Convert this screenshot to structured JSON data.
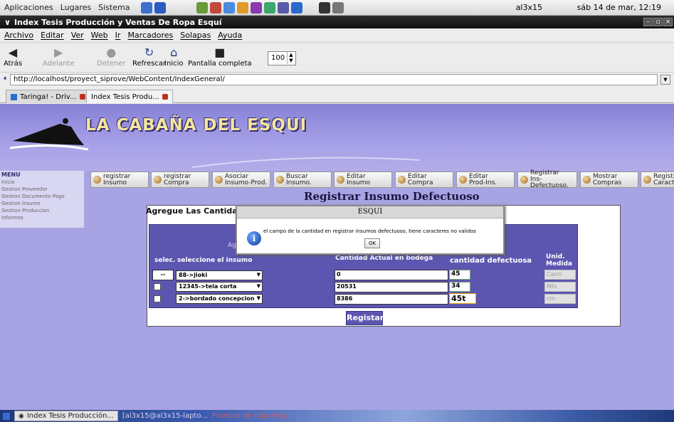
{
  "top_panel": {
    "menus": [
      "Aplicaciones",
      "Lugares",
      "Sistema"
    ],
    "user": "al3x15",
    "clock": "sáb 14 de mar, 12:19"
  },
  "window": {
    "title": "Index Tesis Producción y Ventas De Ropa Esquí"
  },
  "menubar": {
    "items": [
      "Archivo",
      "Editar",
      "Ver",
      "Web",
      "Ir",
      "Marcadores",
      "Solapas",
      "Ayuda"
    ]
  },
  "toolbar": {
    "back": "Atrás",
    "forward": "Adelante",
    "stop": "Detener",
    "reload": "Refrescar",
    "home": "Inicio",
    "fullscreen": "Pantalla completa",
    "zoom": "100"
  },
  "address": {
    "url": "http://localhost/proyect_siprove/WebContent/IndexGeneral/"
  },
  "tabs": [
    {
      "label": "Taringa! - Driv..."
    },
    {
      "label": "Index Tesis Produ..."
    }
  ],
  "site": {
    "title": "LA CABAÑA DEL ESQUI"
  },
  "sidebar": {
    "heading": "MENU",
    "items": [
      "Inicio",
      "Gestion Proveedor",
      "Gestion Documento Pago",
      "Gestion Insumo",
      "Gestion Produccion",
      "Informes"
    ]
  },
  "nav": [
    {
      "l1": "registrar",
      "l2": "Insumo"
    },
    {
      "l1": "registrar",
      "l2": "Compra"
    },
    {
      "l1": "Asociar",
      "l2": "Insumo-Prod."
    },
    {
      "l1": "Buscar",
      "l2": "Insumo."
    },
    {
      "l1": "Editar",
      "l2": "Insumo"
    },
    {
      "l1": "Editar",
      "l2": "Compra"
    },
    {
      "l1": "Editar",
      "l2": "Prod-Ins."
    },
    {
      "l1": "Registrar",
      "l2": "Ins-Defectuoso."
    },
    {
      "l1": "Mostrar",
      "l2": "Compras"
    },
    {
      "l1": "Registr",
      "l2": "Caract"
    }
  ],
  "page": {
    "title": "Registrar Insumo Defectuoso",
    "panel_title": "Agregue Las Cantidades",
    "inner_label": "Ag",
    "headers": {
      "selec": "selec.",
      "insumo": "seleccione el insumo",
      "cantidad": "Cantidad Actual en bodega",
      "defectuosa": "cantidad defectuosa",
      "unidad": "Unid. Medida"
    },
    "rows": [
      {
        "check": "--",
        "insumo": "88->jioki",
        "cantidad": "0",
        "defectuosa": "45",
        "unidad": "Carril"
      },
      {
        "check": "",
        "insumo": "12345->tela corta",
        "cantidad": "20531",
        "defectuosa": "34",
        "unidad": "Mts"
      },
      {
        "check": "",
        "insumo": "2->bordado concepcion",
        "cantidad": "8386",
        "defectuosa": "45t",
        "unidad": "cm"
      }
    ],
    "submit": "Registar"
  },
  "dialog": {
    "title": "ESQUI",
    "message": "el campo de la cantidad en registrar insumos defectuoso, tiene caracteres no validos",
    "ok": "OK"
  },
  "taskbar": {
    "items": [
      "Index Tesis Producción...",
      "[al3x15@al3x15-lapto...",
      "Pruebas de Caja Negr..."
    ]
  }
}
